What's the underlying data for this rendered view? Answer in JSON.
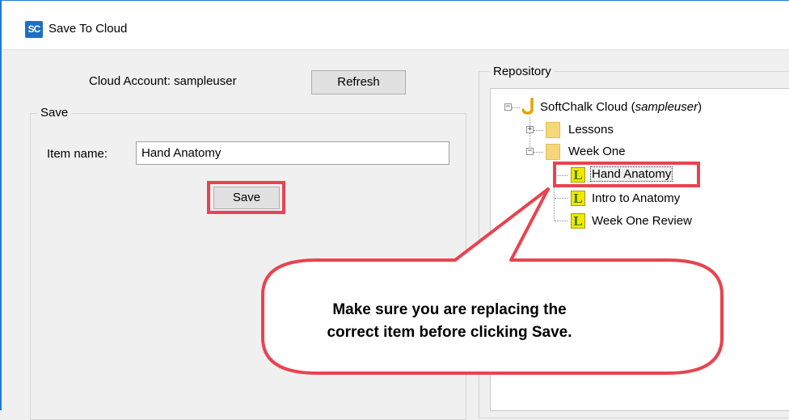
{
  "window": {
    "title": "Save To Cloud",
    "app_icon_text": "SC"
  },
  "account": {
    "label": "Cloud Account: sampleuser",
    "refresh_label": "Refresh"
  },
  "save_group": {
    "label": "Save",
    "item_name_label": "Item name:",
    "item_name_value": "Hand Anatomy",
    "save_label": "Save"
  },
  "repository": {
    "label": "Repository",
    "root": {
      "name": "SoftChalk Cloud",
      "user": "sampleuser"
    },
    "folders": [
      "Lessons",
      "Week One"
    ],
    "items": [
      "Hand Anatomy",
      "Intro to Anatomy",
      "Week One Review"
    ]
  },
  "callout": {
    "line1": "Make sure you are replacing the",
    "line2": "correct item before clicking Save."
  },
  "colors": {
    "highlight": "#e8434f",
    "window_accent": "#1e7bd8"
  }
}
